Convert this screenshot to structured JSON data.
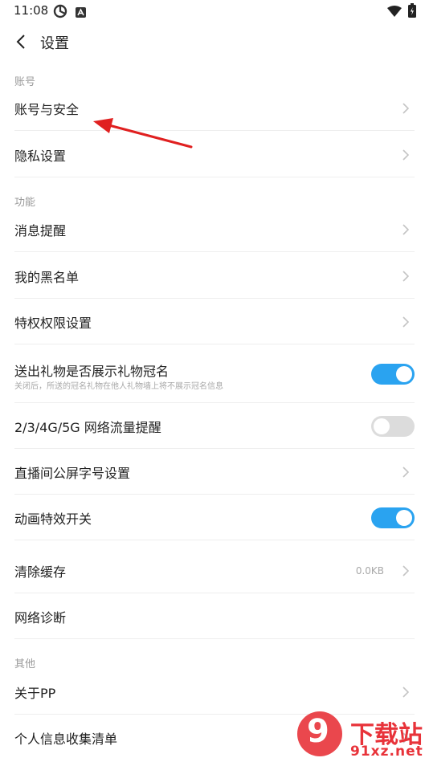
{
  "status_bar": {
    "time": "11:08"
  },
  "header": {
    "title": "设置"
  },
  "sections": {
    "account": {
      "label": "账号",
      "items": {
        "account_security": "账号与安全",
        "privacy": "隐私设置"
      }
    },
    "features": {
      "label": "功能",
      "items": {
        "notifications": "消息提醒",
        "blacklist": "我的黑名单",
        "privilege": "特权权限设置",
        "gift_title": "送出礼物是否展示礼物冠名",
        "gift_title_sub": "关闭后，所送的冠名礼物在他人礼物墙上将不展示冠名信息",
        "data_alert": "2/3/4G/5G 网络流量提醒",
        "font_size": "直播间公屏字号设置",
        "animation": "动画特效开关",
        "clear_cache": "清除缓存",
        "cache_size": "0.0KB",
        "diagnose": "网络诊断"
      }
    },
    "other": {
      "label": "其他",
      "items": {
        "about": "关于PP",
        "personal_info": "个人信息收集清单"
      }
    }
  },
  "toggles": {
    "gift_title": "on",
    "data_alert": "off",
    "animation": "on"
  },
  "colors": {
    "toggle_on": "#2aa3f0",
    "toggle_off": "#dcdcdc",
    "annotation_arrow": "#e02020",
    "watermark": "#e8333a"
  },
  "watermark": {
    "logo": "9",
    "brand": "下载站",
    "domain": "91xz.net"
  }
}
